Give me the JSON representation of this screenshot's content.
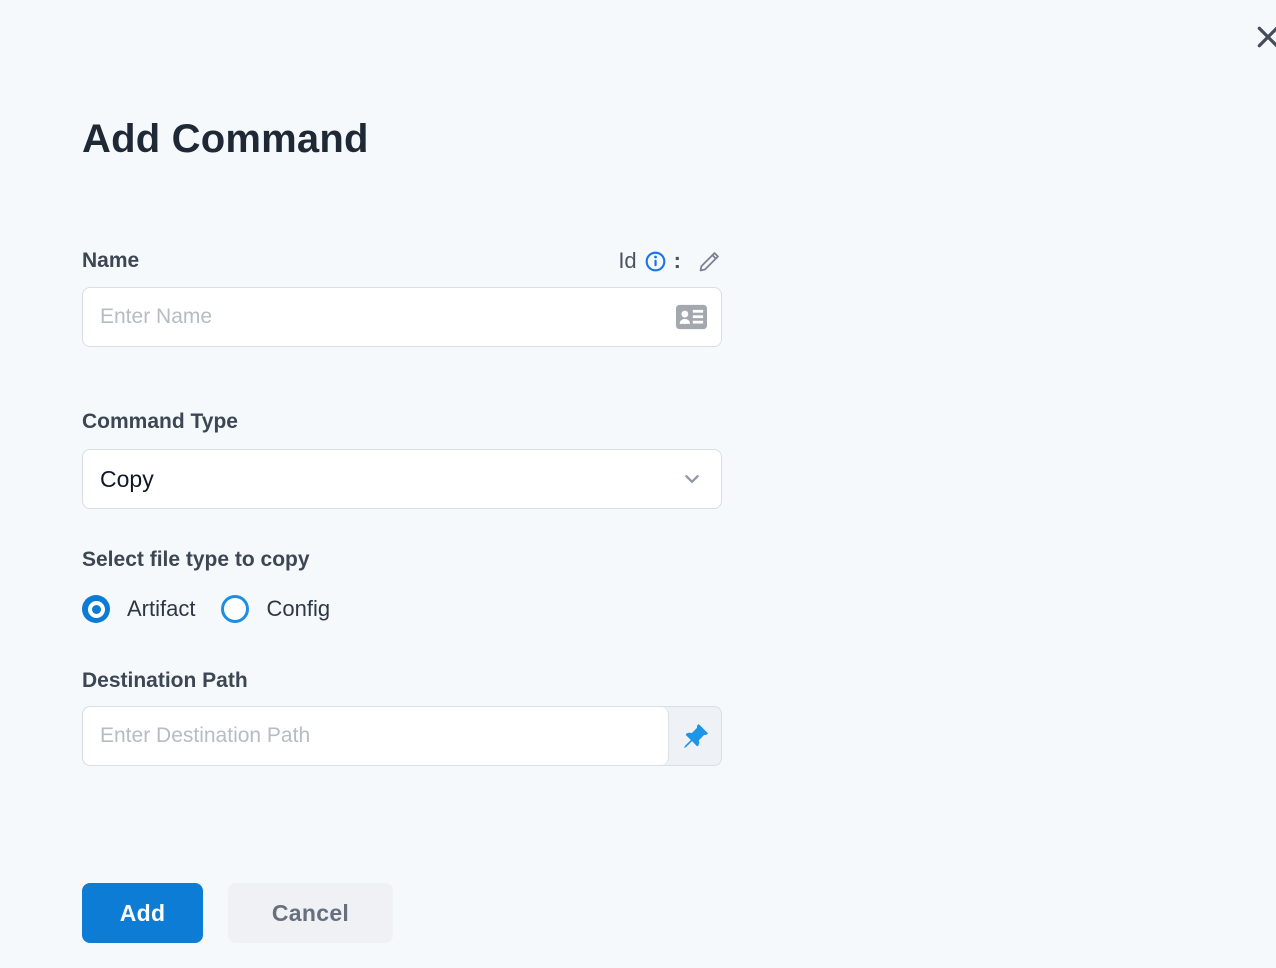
{
  "window": {
    "close_icon": "close"
  },
  "page": {
    "title": "Add Command"
  },
  "form": {
    "name": {
      "label": "Name",
      "placeholder": "Enter Name",
      "id_label": "Id",
      "colon": ":"
    },
    "command_type": {
      "label": "Command Type",
      "value": "Copy"
    },
    "file_type": {
      "label": "Select file type to copy",
      "options": [
        {
          "label": "Artifact",
          "selected": true
        },
        {
          "label": "Config",
          "selected": false
        }
      ]
    },
    "destination": {
      "label": "Destination Path",
      "placeholder": "Enter Destination Path"
    }
  },
  "actions": {
    "add_label": "Add",
    "cancel_label": "Cancel"
  },
  "colors": {
    "background": "#f5f9fc",
    "primary_blue": "#0d7cd4",
    "radio_blue": "#0c7bd3",
    "config_ring_blue": "#1e8fe0",
    "info_blue": "#1a73e8",
    "pin_blue": "#1e96e8",
    "title_text": "#1f2935",
    "label_text": "#3d4753",
    "placeholder_text": "#b5bcc4",
    "input_border": "#d9dee4",
    "cancel_bg": "#eff1f4",
    "cancel_text": "#666f7d"
  }
}
